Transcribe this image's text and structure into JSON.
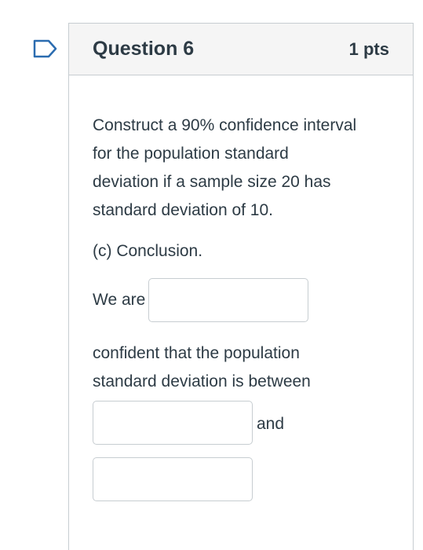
{
  "question": {
    "title": "Question 6",
    "points": "1 pts",
    "prompt_lines": [
      "Construct a 90% confidence interval",
      "for the population standard",
      "deviation if a sample size 20 has",
      "standard deviation of 10."
    ],
    "part": "(c) Conclusion.",
    "lead_text": "We are",
    "middle_lines": [
      "confident that the population",
      "standard deviation is between"
    ],
    "and_text": "and",
    "answers": {
      "confidence": "",
      "lower_bound": "",
      "upper_bound": ""
    }
  },
  "colors": {
    "flag_outline": "#2b6cb0",
    "border": "#c7cdd1",
    "header_bg": "#f5f5f5",
    "text": "#2d3b45"
  },
  "icons": {
    "flag": "bookmark-flag-icon"
  }
}
